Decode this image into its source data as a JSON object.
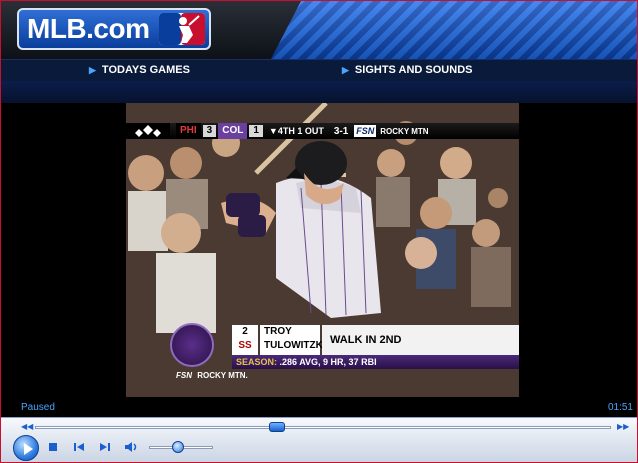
{
  "header": {
    "logo_text": "MLB.com"
  },
  "nav": {
    "items": [
      {
        "label": "TODAYS GAMES"
      },
      {
        "label": "SIGHTS AND SOUNDS"
      }
    ]
  },
  "video": {
    "scorebug": {
      "away_team": "PHI",
      "away_score": "3",
      "home_team": "COL",
      "home_score": "1",
      "inning": "▼4TH 1 OUT",
      "count": "3-1",
      "network": "FSN",
      "network_region": "ROCKY MTN"
    },
    "lower_third": {
      "number": "2",
      "position": "SS",
      "first_name": "TROY",
      "last_name": "TULOWITZKI",
      "note": "WALK IN 2ND",
      "season_label": "SEASON:",
      "season_stats": ".286 AVG, 9 HR, 37 RBI"
    },
    "bottom_bug": {
      "network": "FSN",
      "region": "ROCKY MTN."
    }
  },
  "status": {
    "state": "Paused",
    "time": "01:51"
  },
  "player": {
    "progress": 0.42,
    "volume": 0.45
  }
}
